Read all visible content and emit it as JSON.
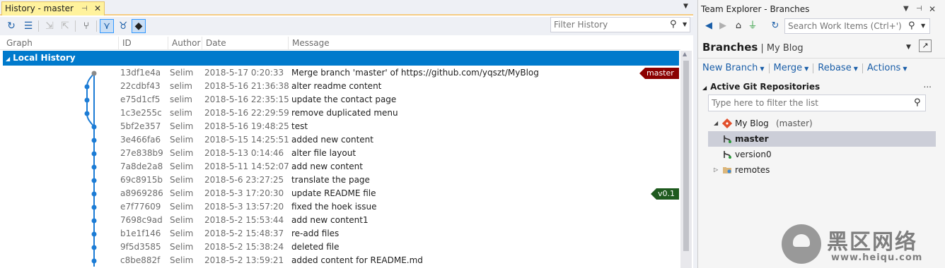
{
  "history": {
    "tab_title": "History - master",
    "pin_glyph": "⊣",
    "filter_placeholder": "Filter History",
    "columns": [
      "Graph",
      "ID",
      "Author",
      "Date",
      "Message"
    ],
    "group_label": "Local History",
    "rows": [
      {
        "id": "13df1e4a",
        "author": "Selim",
        "date": "2018-5-17 0:20:33",
        "message": "Merge branch 'master' of https://github.com/yqszt/MyBlog",
        "tag": "master"
      },
      {
        "id": "22cdbf43",
        "author": "selim",
        "date": "2018-5-16 21:36:38",
        "message": "alter readme content"
      },
      {
        "id": "e75d1cf5",
        "author": "selim",
        "date": "2018-5-16 22:35:15",
        "message": "update the contact page"
      },
      {
        "id": "1c3e255c",
        "author": "selim",
        "date": "2018-5-16 22:29:59",
        "message": "remove duplicated menu"
      },
      {
        "id": "5bf2e357",
        "author": "Selim",
        "date": "2018-5-16 19:48:25",
        "message": "test"
      },
      {
        "id": "3e466fa6",
        "author": "Selim",
        "date": "2018-5-15 14:25:51",
        "message": "added new content"
      },
      {
        "id": "27e838b9",
        "author": "Selim",
        "date": "2018-5-13 0:14:46",
        "message": "alter file layout"
      },
      {
        "id": "7a8de2a8",
        "author": "Selim",
        "date": "2018-5-11 14:52:07",
        "message": "add new content"
      },
      {
        "id": "69c8915b",
        "author": "Selim",
        "date": "2018-5-6 23:27:25",
        "message": "translate the page"
      },
      {
        "id": "a8969286",
        "author": "Selim",
        "date": "2018-5-3 17:20:30",
        "message": "update README file",
        "tag": "v0.1"
      },
      {
        "id": "e7f77609",
        "author": "Selim",
        "date": "2018-5-3 13:57:20",
        "message": "fixed the hoek issue"
      },
      {
        "id": "7698c9ad",
        "author": "Selim",
        "date": "2018-5-2 15:53:44",
        "message": "add new content1"
      },
      {
        "id": "b1e1f146",
        "author": "Selim",
        "date": "2018-5-2 15:48:37",
        "message": "re-add files"
      },
      {
        "id": "9f5d3585",
        "author": "Selim",
        "date": "2018-5-2 15:38:24",
        "message": "deleted file"
      },
      {
        "id": "c8be882f",
        "author": "Selim",
        "date": "2018-5-2 13:59:21",
        "message": "added content for README.md"
      }
    ]
  },
  "team_explorer": {
    "title": "Team Explorer - Branches",
    "search_placeholder": "Search Work Items (Ctrl+')",
    "heading": "Branches",
    "heading_sub": "| My Blog",
    "actions": [
      "New Branch",
      "Merge",
      "Rebase",
      "Actions"
    ],
    "section_title": "Active Git Repositories",
    "section_more": "...",
    "filter_placeholder": "Type here to filter the list",
    "repo_name": "My Blog",
    "repo_branch": "(master)",
    "branches": [
      {
        "name": "master",
        "selected": true
      },
      {
        "name": "version0",
        "selected": false
      }
    ],
    "remotes_label": "remotes"
  },
  "watermark": {
    "title": "黑区网络",
    "url": "www.heiqu.com"
  },
  "colors": {
    "accent": "#007acc",
    "tab_active": "#fff29d",
    "tag_master": "#8b0000",
    "tag_version": "#1e5a1e",
    "graph_main": "#1c7cd5",
    "graph_merge": "#8a8a8a"
  }
}
